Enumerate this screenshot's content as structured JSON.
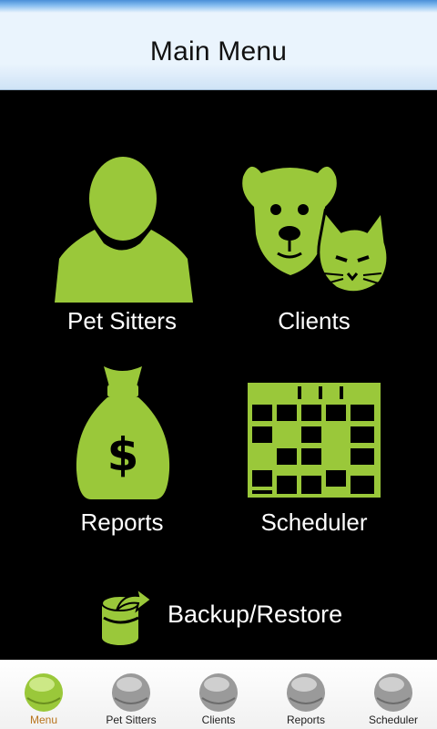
{
  "header": {
    "title": "Main Menu"
  },
  "menu": {
    "tiles": [
      {
        "label": "Pet Sitters",
        "icon": "person-icon"
      },
      {
        "label": "Clients",
        "icon": "dog-cat-icon"
      },
      {
        "label": "Reports",
        "icon": "money-bag-icon"
      },
      {
        "label": "Scheduler",
        "icon": "calendar-grid-icon"
      }
    ],
    "backup": {
      "label": "Backup/Restore",
      "icon": "backup-icon"
    }
  },
  "tabbar": {
    "tabs": [
      {
        "label": "Menu",
        "active": true
      },
      {
        "label": "Pet Sitters",
        "active": false
      },
      {
        "label": "Clients",
        "active": false
      },
      {
        "label": "Reports",
        "active": false
      },
      {
        "label": "Scheduler",
        "active": false
      }
    ]
  },
  "colors": {
    "accent_green": "#9ac83a",
    "tab_inactive": "#9a9a9a",
    "tab_active_label": "#b8741c",
    "header_bg": "#eaf4fd"
  }
}
